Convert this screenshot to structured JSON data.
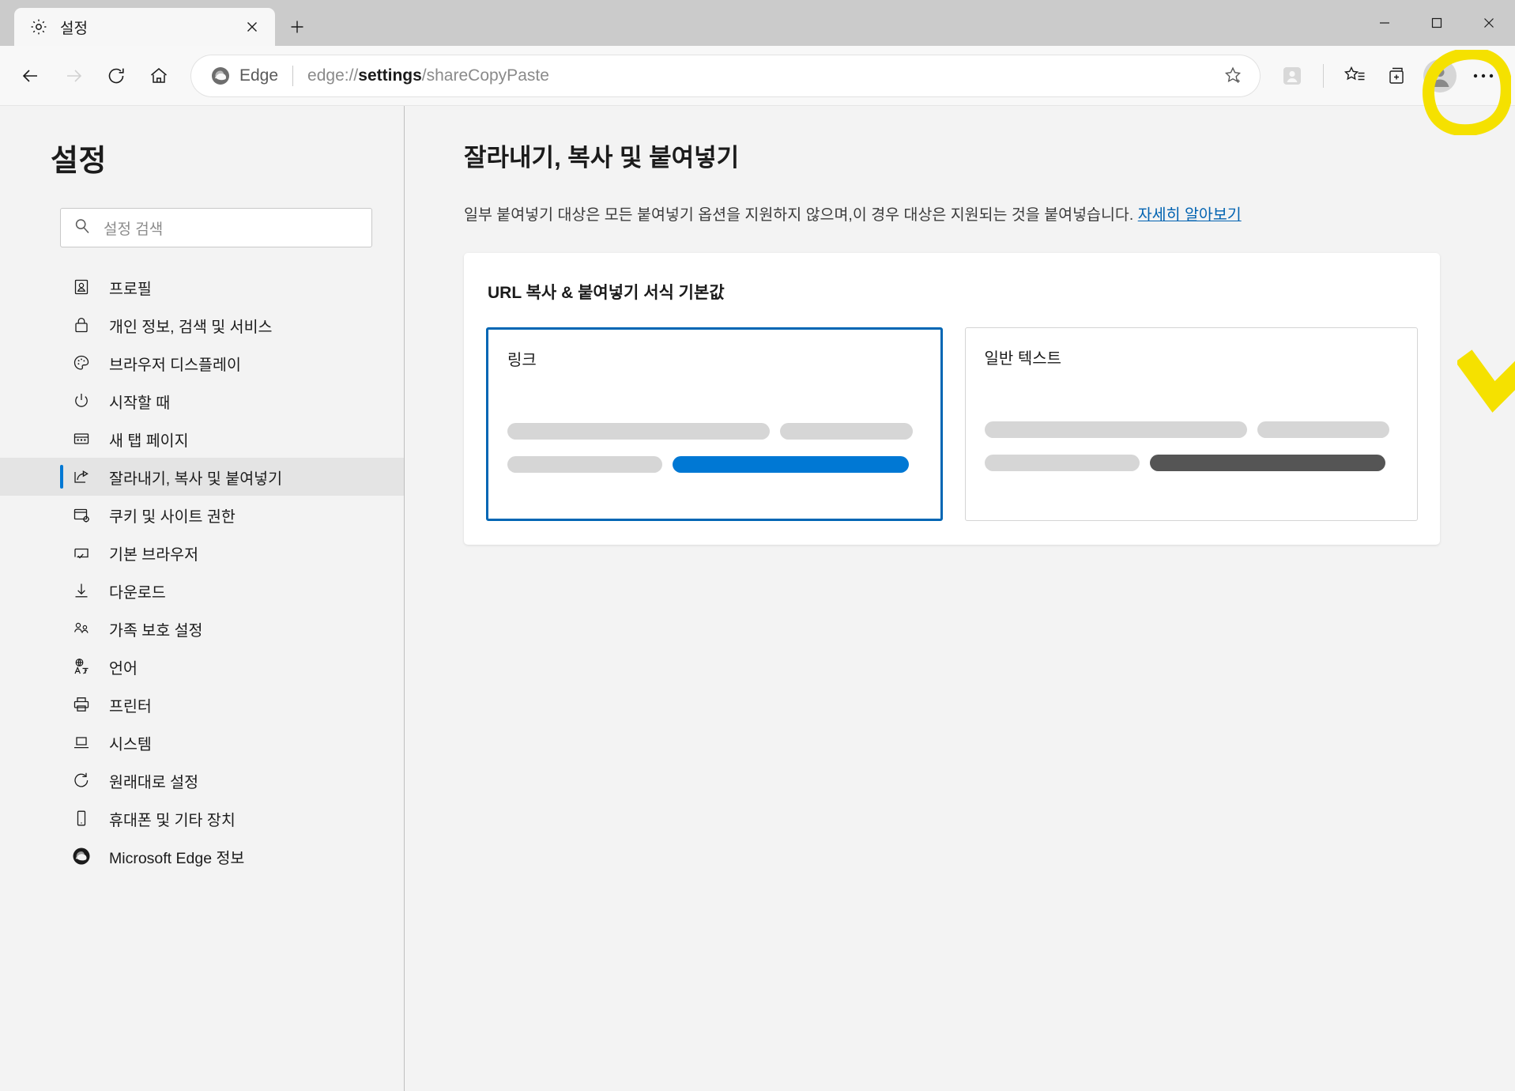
{
  "window": {
    "controls": {
      "minimize": "minimize-icon",
      "maximize": "maximize-icon",
      "close": "close-icon"
    }
  },
  "tab": {
    "title": "설정",
    "favicon": "gear-icon",
    "close_label": "×",
    "new_tab_label": "+"
  },
  "toolbar": {
    "back": "back-arrow-icon",
    "forward": "forward-arrow-icon",
    "refresh": "refresh-icon",
    "home": "home-icon",
    "brand_label": "Edge",
    "url_prefix": "edge://",
    "url_bold": "settings",
    "url_suffix": "/shareCopyPaste",
    "favorite": "star-plus-icon",
    "reading": "reading-mode-icon",
    "favorites_list": "favorites-list-icon",
    "collections": "collections-icon",
    "profile": "profile-avatar-icon",
    "more": "more-dots-icon"
  },
  "sidebar": {
    "title": "설정",
    "search": {
      "placeholder": "설정 검색",
      "value": "",
      "icon": "search-icon"
    },
    "items": [
      {
        "label": "프로필",
        "icon": "profile-card-icon",
        "active": false
      },
      {
        "label": "개인 정보, 검색 및 서비스",
        "icon": "lock-icon",
        "active": false
      },
      {
        "label": "브라우저 디스플레이",
        "icon": "palette-icon",
        "active": false
      },
      {
        "label": "시작할 때",
        "icon": "power-icon",
        "active": false
      },
      {
        "label": "새 탭 페이지",
        "icon": "new-tab-page-icon",
        "active": false
      },
      {
        "label": "잘라내기, 복사 및 붙여넣기",
        "icon": "share-icon",
        "active": true
      },
      {
        "label": "쿠키 및 사이트 권한",
        "icon": "cookie-settings-icon",
        "active": false
      },
      {
        "label": "기본 브라우저",
        "icon": "default-browser-icon",
        "active": false
      },
      {
        "label": "다운로드",
        "icon": "download-icon",
        "active": false
      },
      {
        "label": "가족 보호 설정",
        "icon": "family-icon",
        "active": false
      },
      {
        "label": "언어",
        "icon": "language-icon",
        "active": false
      },
      {
        "label": "프린터",
        "icon": "printer-icon",
        "active": false
      },
      {
        "label": "시스템",
        "icon": "system-icon",
        "active": false
      },
      {
        "label": "원래대로 설정",
        "icon": "reset-icon",
        "active": false
      },
      {
        "label": "휴대폰 및 기타 장치",
        "icon": "phone-icon",
        "active": false
      },
      {
        "label": "Microsoft Edge 정보",
        "icon": "edge-logo-icon",
        "active": false
      }
    ]
  },
  "main": {
    "heading": "잘라내기, 복사 및 붙여넣기",
    "description": "일부 붙여넣기 대상은 모든 붙여넣기 옵션을 지원하지 않으며,이 경우 대상은 지원되는 것을 붙여넣습니다.",
    "learn_more": "자세히 알아보기",
    "card": {
      "title": "URL 복사 & 붙여넣기 서식 기본값",
      "options": [
        {
          "label": "링크",
          "selected": true,
          "accent": "#0078d4"
        },
        {
          "label": "일반 텍스트",
          "selected": false,
          "accent": "#555555"
        }
      ]
    }
  },
  "annotations": {
    "circle_target": "more-dots-button",
    "check_target": "plain-text-option",
    "color": "#f5e100"
  },
  "colors": {
    "accent_blue": "#0078d4",
    "selected_border": "#0066b4",
    "link_blue": "#0263b1",
    "annotation_yellow": "#f5e100",
    "titlebar": "#cbcbcb",
    "sidebar_bg": "#f3f3f3",
    "content_bg": "#f3f3f3"
  }
}
